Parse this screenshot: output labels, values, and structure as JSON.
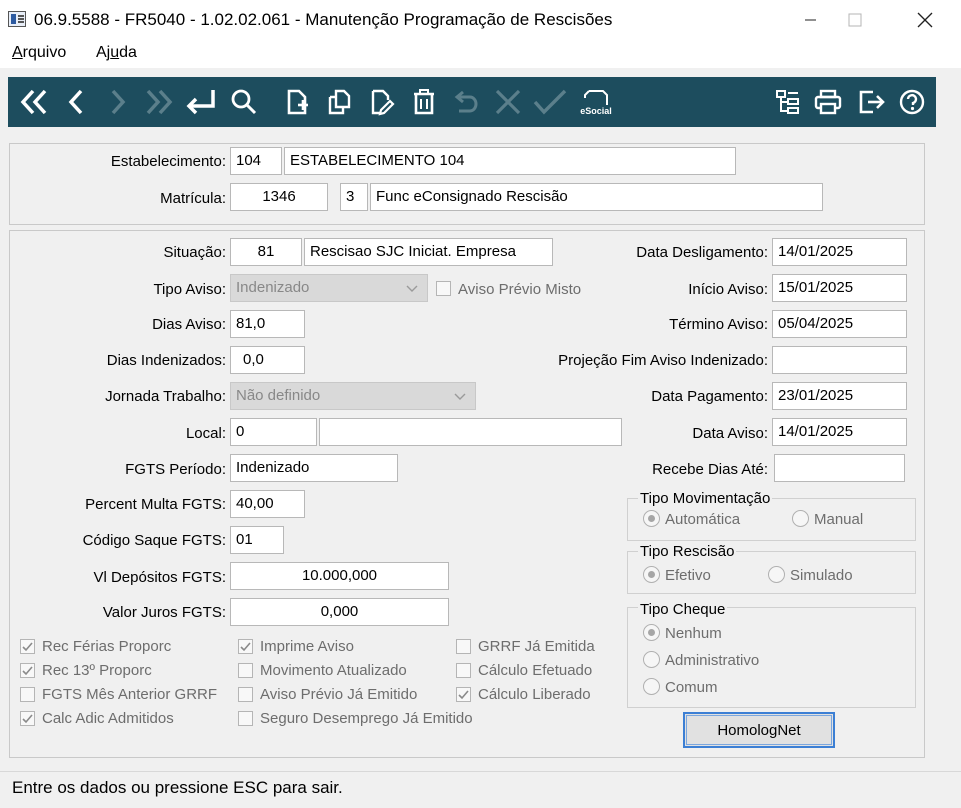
{
  "window": {
    "title": "06.9.5588 - FR5040 - 1.02.02.061 - Manutenção Programação de Rescisões"
  },
  "menu": {
    "arquivo": "Arquivo",
    "ajuda": "Ajuda"
  },
  "toolbar": {
    "buttons": [
      "first-icon",
      "previous-icon",
      "next-icon",
      "last-icon",
      "goto-icon",
      "search-icon",
      "new-icon",
      "copy-icon",
      "edit-icon",
      "delete-icon",
      "undo-icon",
      "cancel-icon",
      "confirm-icon",
      "esocial-icon",
      "tree-icon",
      "print-icon",
      "exit-icon",
      "help-icon"
    ],
    "esocial_label": "eSocial",
    "accent": "#1d4d5e"
  },
  "header": {
    "estabelecimento_label": "Estabelecimento:",
    "estabelecimento_code": "104",
    "estabelecimento_name": "ESTABELECIMENTO 104",
    "matricula_label": "Matrícula:",
    "matricula_code": "1346",
    "matricula_seq": "3",
    "matricula_name": "Func eConsignado Rescisão"
  },
  "form": {
    "situacao_label": "Situação:",
    "situacao_code": "81",
    "situacao_desc": "Rescisao SJC Iniciat. Empresa",
    "tipo_aviso_label": "Tipo Aviso:",
    "tipo_aviso_value": "Indenizado",
    "aviso_previo_misto_label": "Aviso Prévio Misto",
    "dias_aviso_label": "Dias Aviso:",
    "dias_aviso_value": "81,0",
    "dias_indenizados_label": "Dias Indenizados:",
    "dias_indenizados_value": "0,0",
    "jornada_label": "Jornada Trabalho:",
    "jornada_value": "Não definido",
    "local_label": "Local:",
    "local_code": "0",
    "local_desc": "",
    "fgts_periodo_label": "FGTS Período:",
    "fgts_periodo_value": "Indenizado",
    "percent_multa_label": "Percent Multa FGTS:",
    "percent_multa_value": "40,00",
    "codigo_saque_label": "Código Saque FGTS:",
    "codigo_saque_value": "01",
    "vl_depositos_label": "Vl Depósitos FGTS:",
    "vl_depositos_value": "10.000,000",
    "valor_juros_label": "Valor Juros FGTS:",
    "valor_juros_value": "0,000",
    "data_desligamento_label": "Data Desligamento:",
    "data_desligamento_value": "14/01/2025",
    "inicio_aviso_label": "Início Aviso:",
    "inicio_aviso_value": "15/01/2025",
    "termino_aviso_label": "Término Aviso:",
    "termino_aviso_value": "05/04/2025",
    "projecao_label": "Projeção Fim Aviso Indenizado:",
    "projecao_value": "",
    "data_pagamento_label": "Data Pagamento:",
    "data_pagamento_value": "23/01/2025",
    "data_aviso_label": "Data Aviso:",
    "data_aviso_value": "14/01/2025",
    "recebe_dias_label": "Recebe Dias Até:",
    "recebe_dias_value": ""
  },
  "checkboxes": [
    {
      "label": "Rec Férias Proporc",
      "checked": true
    },
    {
      "label": "Rec 13º Proporc",
      "checked": true
    },
    {
      "label": "FGTS Mês Anterior GRRF",
      "checked": false
    },
    {
      "label": "Calc Adic Admitidos",
      "checked": true
    },
    {
      "label": "Imprime Aviso",
      "checked": true
    },
    {
      "label": "Movimento Atualizado",
      "checked": false
    },
    {
      "label": "Aviso Prévio Já Emitido",
      "checked": false
    },
    {
      "label": "Seguro Desemprego Já Emitido",
      "checked": false
    },
    {
      "label": "GRRF Já Emitida",
      "checked": false
    },
    {
      "label": "Cálculo Efetuado",
      "checked": false
    },
    {
      "label": "Cálculo Liberado",
      "checked": true
    }
  ],
  "tipo_movimentacao": {
    "title": "Tipo Movimentação",
    "options": [
      "Automática",
      "Manual"
    ],
    "selected": "Automática"
  },
  "tipo_rescisao": {
    "title": "Tipo Rescisão",
    "options": [
      "Efetivo",
      "Simulado"
    ],
    "selected": "Efetivo"
  },
  "tipo_cheque": {
    "title": "Tipo Cheque",
    "options": [
      "Nenhum",
      "Administrativo",
      "Comum"
    ],
    "selected": "Nenhum"
  },
  "homolognet_label": "HomologNet",
  "status": "Entre os dados ou pressione ESC para sair."
}
